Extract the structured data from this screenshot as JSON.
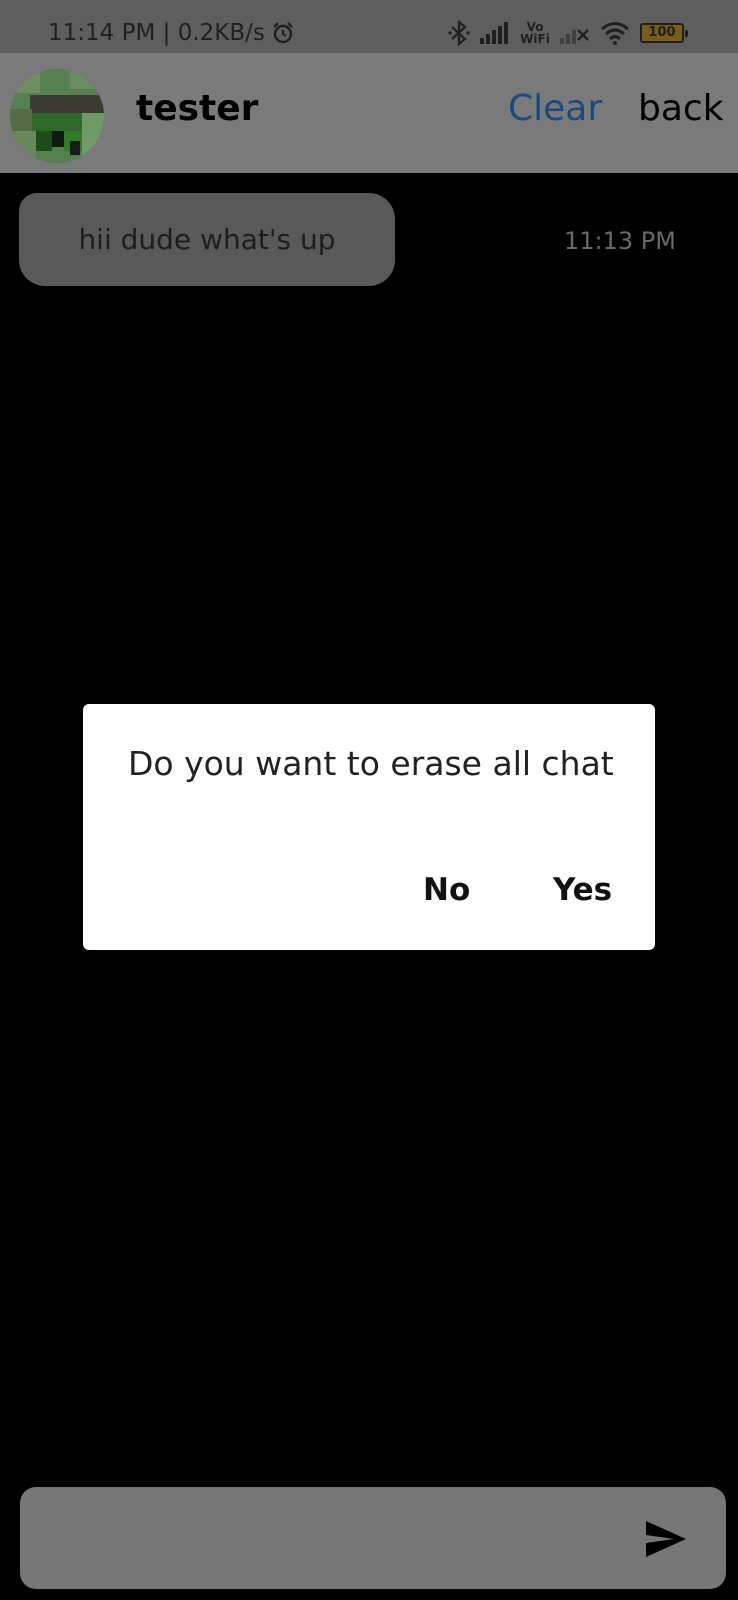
{
  "status_bar": {
    "time": "11:14 PM",
    "net_speed": "0.2KB/s",
    "vowifi_top": "Vo",
    "vowifi_bottom": "WiFi",
    "battery": "100",
    "icons": [
      "alarm-icon",
      "bluetooth-icon",
      "signal-icon",
      "vowifi-icon",
      "signal-muted-icon",
      "wifi-icon",
      "battery-icon"
    ]
  },
  "header": {
    "contact_name": "tester",
    "clear_label": "Clear",
    "back_label": "back",
    "clear_color": "#184a7d"
  },
  "messages": [
    {
      "text": "hii dude what's up",
      "time": "11:13 PM"
    }
  ],
  "dialog": {
    "title": "Do you want to erase all chat",
    "no_label": "No",
    "yes_label": "Yes"
  },
  "input": {
    "value": "",
    "placeholder": "",
    "send_icon": "send-icon"
  }
}
